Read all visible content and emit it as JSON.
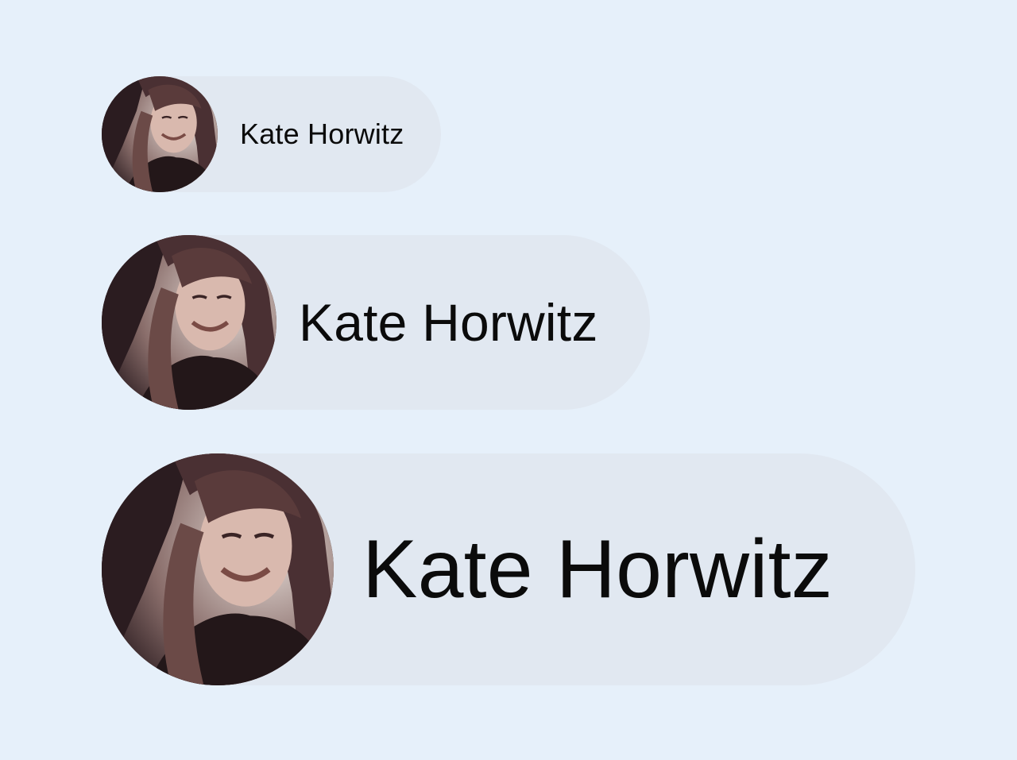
{
  "chips": [
    {
      "name": "Kate Horwitz",
      "size": "small",
      "avatar_alt": "Kate Horwitz avatar"
    },
    {
      "name": "Kate Horwitz",
      "size": "medium",
      "avatar_alt": "Kate Horwitz avatar"
    },
    {
      "name": "Kate Horwitz",
      "size": "large",
      "avatar_alt": "Kate Horwitz avatar"
    }
  ],
  "colors": {
    "background": "#e6f0fa",
    "chip": "#e1e8f1",
    "text": "#0b0b0b"
  }
}
